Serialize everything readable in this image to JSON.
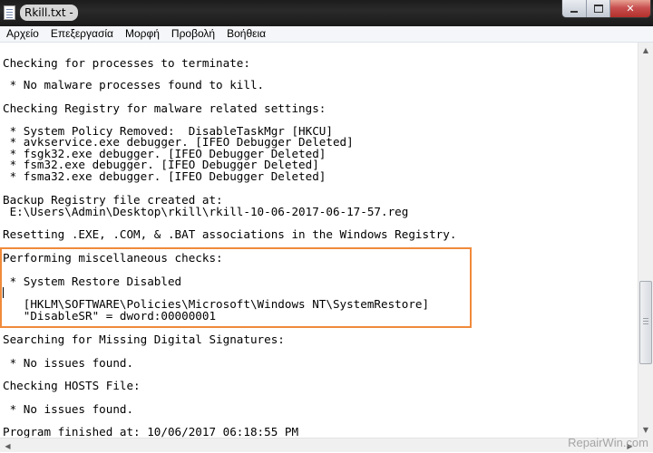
{
  "window": {
    "title": "Rkill.txt -",
    "buttons": {
      "minimize_icon": "minimize-icon",
      "maximize_icon": "maximize-icon",
      "close_glyph": "✕"
    }
  },
  "menu": {
    "items": [
      "Αρχείο",
      "Επεξεργασία",
      "Μορφή",
      "Προβολή",
      "Βοήθεια"
    ]
  },
  "editor": {
    "lines": [
      "Checking for processes to terminate:",
      "",
      " * No malware processes found to kill.",
      "",
      "Checking Registry for malware related settings:",
      "",
      " * System Policy Removed:  DisableTaskMgr [HKCU]",
      " * avkservice.exe debugger. [IFEO Debugger Deleted]",
      " * fsgk32.exe debugger. [IFEO Debugger Deleted]",
      " * fsm32.exe debugger. [IFEO Debugger Deleted]",
      " * fsma32.exe debugger. [IFEO Debugger Deleted]",
      "",
      "Backup Registry file created at:",
      " E:\\Users\\Admin\\Desktop\\rkill\\rkill-10-06-2017-06-17-57.reg",
      "",
      "Resetting .EXE, .COM, & .BAT associations in the Windows Registry.",
      "",
      "Performing miscellaneous checks:",
      "",
      " * System Restore Disabled",
      "",
      "   [HKLM\\SOFTWARE\\Policies\\Microsoft\\Windows NT\\SystemRestore]",
      "   \"DisableSR\" = dword:00000001",
      "",
      "Searching for Missing Digital Signatures:",
      "",
      " * No issues found.",
      "",
      "Checking HOSTS File:",
      "",
      " * No issues found.",
      "",
      "Program finished at: 10/06/2017 06:18:55 PM"
    ],
    "highlight_color": "#f08a3a"
  },
  "watermark": "RepairWin.com"
}
